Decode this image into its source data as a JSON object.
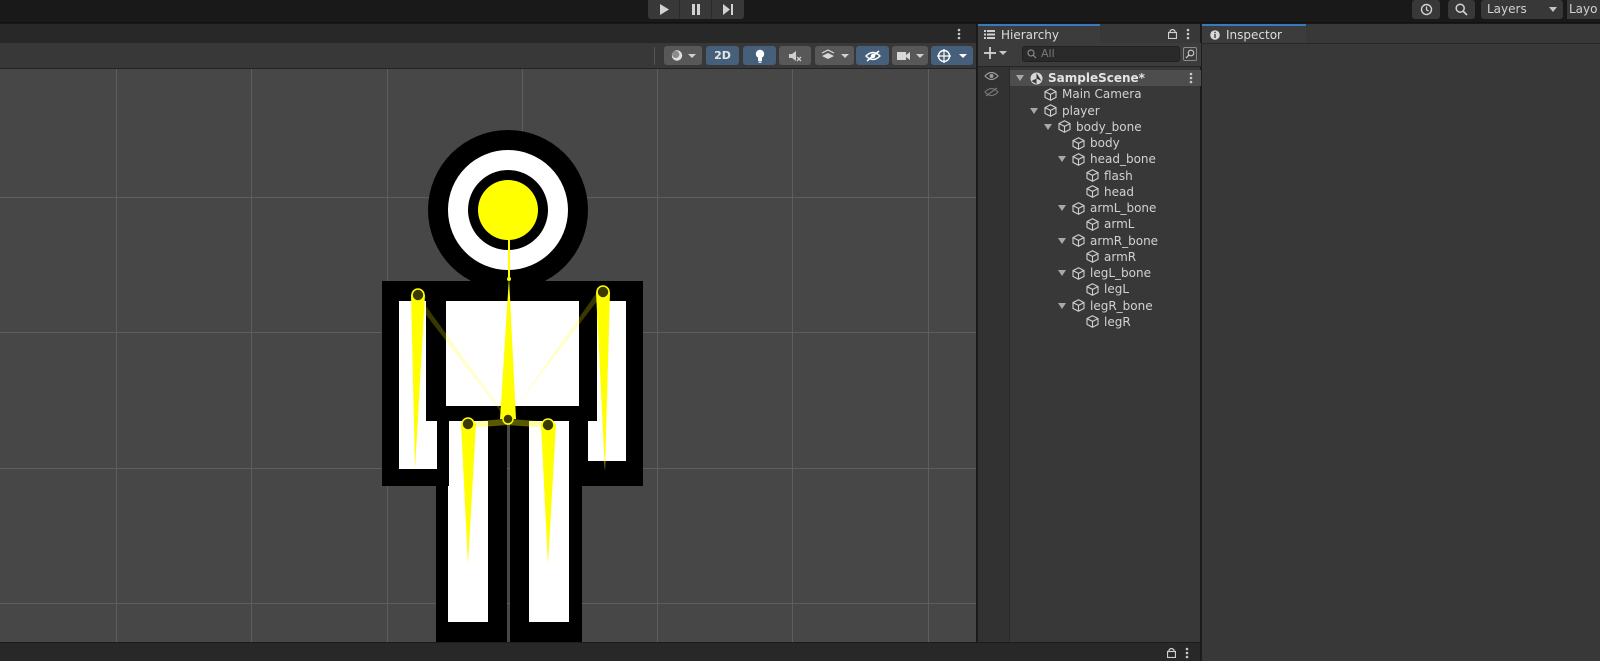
{
  "toolbar": {
    "play_icon": "play-icon",
    "pause_icon": "pause-icon",
    "step_icon": "step-icon",
    "history_icon": "history-icon",
    "search_icon": "search-icon",
    "layers_label": "Layers",
    "layout_label": "Layo"
  },
  "scene_view": {
    "mode_2d_label": "2D",
    "bg_color": "#474747",
    "grid_color": "#5e5e5e",
    "bone_color": "#ffff00"
  },
  "hierarchy": {
    "tab_label": "Hierarchy",
    "search_placeholder": "All",
    "items": [
      {
        "label": "SampleScene*",
        "depth": 0,
        "foldable": true,
        "scene": true
      },
      {
        "label": "Main Camera",
        "depth": 1,
        "foldable": false
      },
      {
        "label": "player",
        "depth": 1,
        "foldable": true
      },
      {
        "label": "body_bone",
        "depth": 2,
        "foldable": true
      },
      {
        "label": "body",
        "depth": 3,
        "foldable": false
      },
      {
        "label": "head_bone",
        "depth": 3,
        "foldable": true
      },
      {
        "label": "flash",
        "depth": 4,
        "foldable": false
      },
      {
        "label": "head",
        "depth": 4,
        "foldable": false
      },
      {
        "label": "armL_bone",
        "depth": 3,
        "foldable": true
      },
      {
        "label": "armL",
        "depth": 4,
        "foldable": false
      },
      {
        "label": "armR_bone",
        "depth": 3,
        "foldable": true
      },
      {
        "label": "armR",
        "depth": 4,
        "foldable": false
      },
      {
        "label": "legL_bone",
        "depth": 3,
        "foldable": true
      },
      {
        "label": "legL",
        "depth": 4,
        "foldable": false
      },
      {
        "label": "legR_bone",
        "depth": 3,
        "foldable": true
      },
      {
        "label": "legR",
        "depth": 4,
        "foldable": false
      }
    ]
  },
  "inspector": {
    "tab_label": "Inspector"
  },
  "colors": {
    "accent": "#3a79bb",
    "panel": "#383838",
    "active_tool": "#46607c"
  }
}
